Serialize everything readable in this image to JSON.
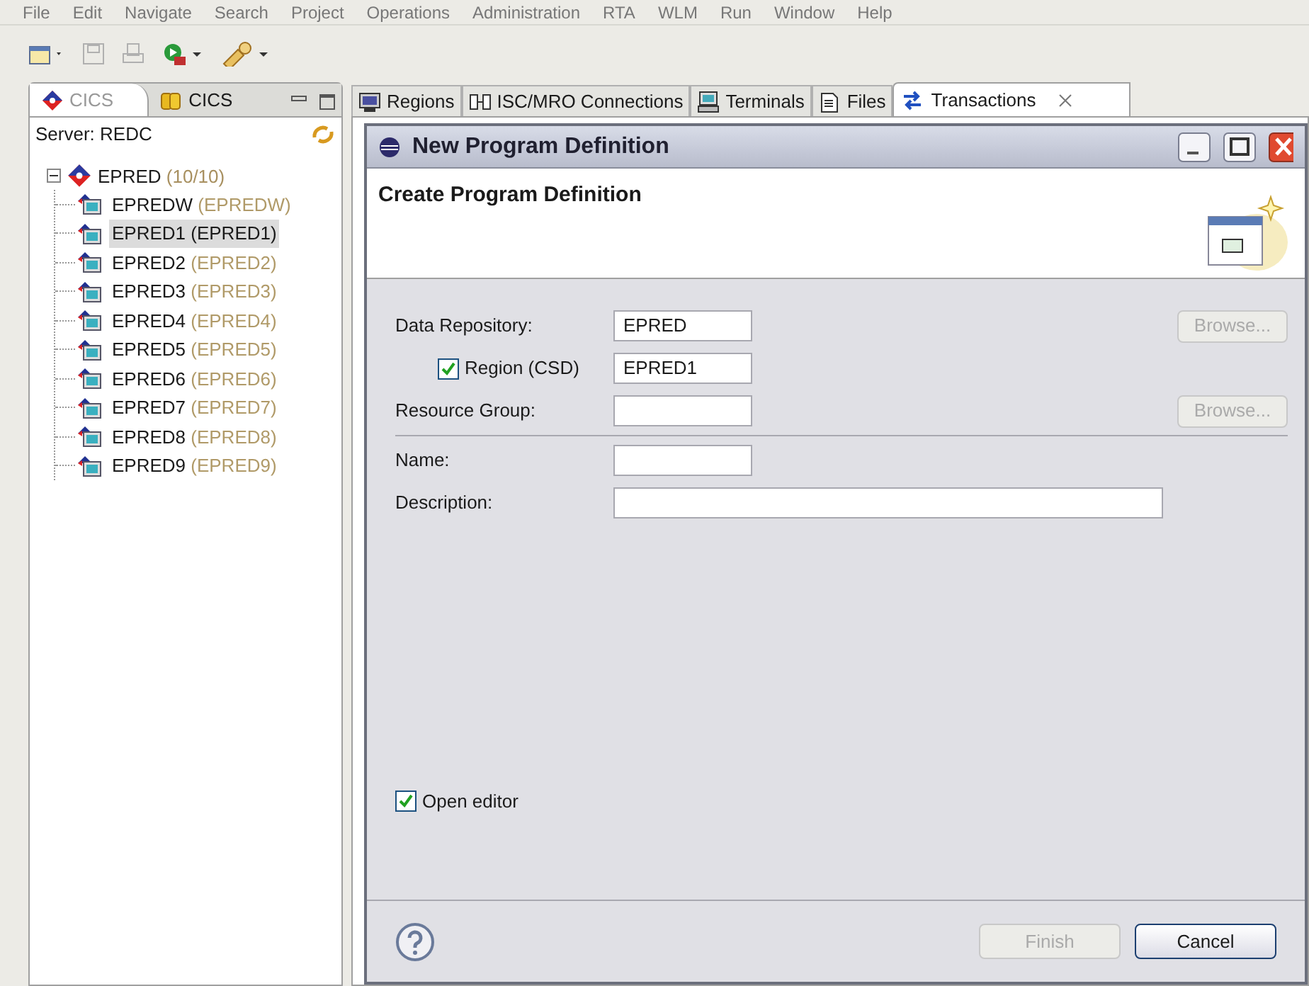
{
  "menu": [
    "File",
    "Edit",
    "Navigate",
    "Search",
    "Project",
    "Operations",
    "Administration",
    "RTA",
    "WLM",
    "Run",
    "Window",
    "Help"
  ],
  "left_tabs": [
    {
      "label": "CICS",
      "selected": true
    },
    {
      "label": "CICS",
      "selected": false
    }
  ],
  "server_label": "Server: REDC",
  "tree": {
    "label": "EPRED",
    "count": "(10/10)",
    "expanded": true,
    "children": [
      {
        "name": "EPREDW",
        "qualifier": "(EPREDW)",
        "selected": false
      },
      {
        "name": "EPRED1",
        "qualifier": "(EPRED1)",
        "selected": true
      },
      {
        "name": "EPRED2",
        "qualifier": "(EPRED2)",
        "selected": false
      },
      {
        "name": "EPRED3",
        "qualifier": "(EPRED3)",
        "selected": false
      },
      {
        "name": "EPRED4",
        "qualifier": "(EPRED4)",
        "selected": false
      },
      {
        "name": "EPRED5",
        "qualifier": "(EPRED5)",
        "selected": false
      },
      {
        "name": "EPRED6",
        "qualifier": "(EPRED6)",
        "selected": false
      },
      {
        "name": "EPRED7",
        "qualifier": "(EPRED7)",
        "selected": false
      },
      {
        "name": "EPRED8",
        "qualifier": "(EPRED8)",
        "selected": false
      },
      {
        "name": "EPRED9",
        "qualifier": "(EPRED9)",
        "selected": false
      }
    ]
  },
  "editor_tabs": [
    {
      "label": "Regions",
      "selected": false
    },
    {
      "label": "ISC/MRO Connections",
      "selected": false
    },
    {
      "label": "Terminals",
      "selected": false
    },
    {
      "label": "Files",
      "selected": false
    },
    {
      "label": "Transactions",
      "selected": true
    }
  ],
  "dialog": {
    "title": "New Program Definition",
    "heading": "Create Program Definition",
    "fields": [
      {
        "kind": "text",
        "label": "Data Repository:",
        "value": "EPRED",
        "wide": false,
        "browse": {
          "label": "Browse...",
          "disabled": true
        }
      },
      {
        "kind": "checkbox",
        "label": "Region (CSD)",
        "checked": true,
        "value": "EPRED1",
        "wide": false
      },
      {
        "kind": "text",
        "label": "Resource Group:",
        "wide": false,
        "browse": {
          "label": "Browse...",
          "disabled": true
        }
      },
      {
        "kind": "separator"
      },
      {
        "kind": "text",
        "label": "Name:",
        "wide": false
      },
      {
        "kind": "text",
        "label": "Description:",
        "wide": true
      }
    ],
    "open_editor": {
      "label": "Open editor",
      "checked": true
    },
    "buttons": [
      {
        "label": "Finish",
        "disabled": true
      },
      {
        "label": "Cancel",
        "disabled": false
      }
    ]
  }
}
